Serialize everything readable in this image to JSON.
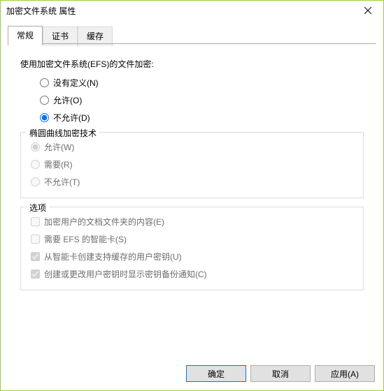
{
  "window": {
    "title": "加密文件系统 属性"
  },
  "tabs": {
    "t0": "常规",
    "t1": "证书",
    "t2": "缓存"
  },
  "section1": {
    "heading": "使用加密文件系统(EFS)的文件加密:",
    "opt0": "没有定义(N)",
    "opt1": "允许(O)",
    "opt2": "不允许(D)"
  },
  "section2": {
    "legend": "椭圆曲线加密技术",
    "opt0": "允许(W)",
    "opt1": "需要(R)",
    "opt2": "不允许(T)"
  },
  "section3": {
    "legend": "选项",
    "opt0": "加密用户的文档文件夹的内容(E)",
    "opt1": "需要 EFS 的智能卡(S)",
    "opt2": "从智能卡创建支持缓存的用户密钥(U)",
    "opt3": "创建或更改用户密钥时显示密钥备份通知(C)"
  },
  "footer": {
    "ok": "确定",
    "cancel": "取消",
    "apply": "应用(A)"
  }
}
